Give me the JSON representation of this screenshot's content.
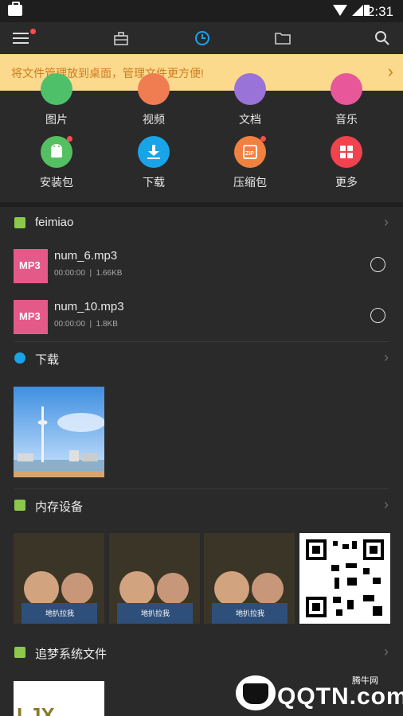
{
  "status": {
    "time": "2:31"
  },
  "banner": {
    "text": "将文件管理放到桌面，管理文件更方便!"
  },
  "categories_top": [
    {
      "label": "图片",
      "color": "#4fc06a"
    },
    {
      "label": "视频",
      "color": "#f07d52"
    },
    {
      "label": "文档",
      "color": "#9a73d8"
    },
    {
      "label": "音乐",
      "color": "#e7579a"
    }
  ],
  "categories": [
    {
      "label": "安装包",
      "color": "#55c062",
      "icon": "android-icon"
    },
    {
      "label": "下载",
      "color": "#1aa4e8",
      "icon": "download-icon"
    },
    {
      "label": "压缩包",
      "color": "#f0813f",
      "icon": "zip-icon"
    },
    {
      "label": "更多",
      "color": "#f0434e",
      "icon": "grid-icon"
    }
  ],
  "sections": {
    "feimiao": {
      "title": "feimiao"
    },
    "download": {
      "title": "下载"
    },
    "internal": {
      "title": "内存设备"
    },
    "system": {
      "title": "追梦系统文件"
    }
  },
  "files": [
    {
      "name": "num_6.mp3",
      "duration": "00:00:00",
      "size": "1.66KB",
      "badge": "MP3"
    },
    {
      "name": "num_10.mp3",
      "duration": "00:00:00",
      "size": "1.8KB",
      "badge": "MP3"
    }
  ],
  "thumb_captions": {
    "kid": "地扒拉我"
  },
  "thumb_lettering": {
    "partial": "LJX"
  },
  "watermark": {
    "brand": "QQTN.com",
    "tag": "腾牛网"
  },
  "colors": {
    "accent": "#1aa4e8",
    "banner_bg": "#fbd98d",
    "banner_text": "#d07d1f",
    "bg": "#2a2a2b"
  }
}
